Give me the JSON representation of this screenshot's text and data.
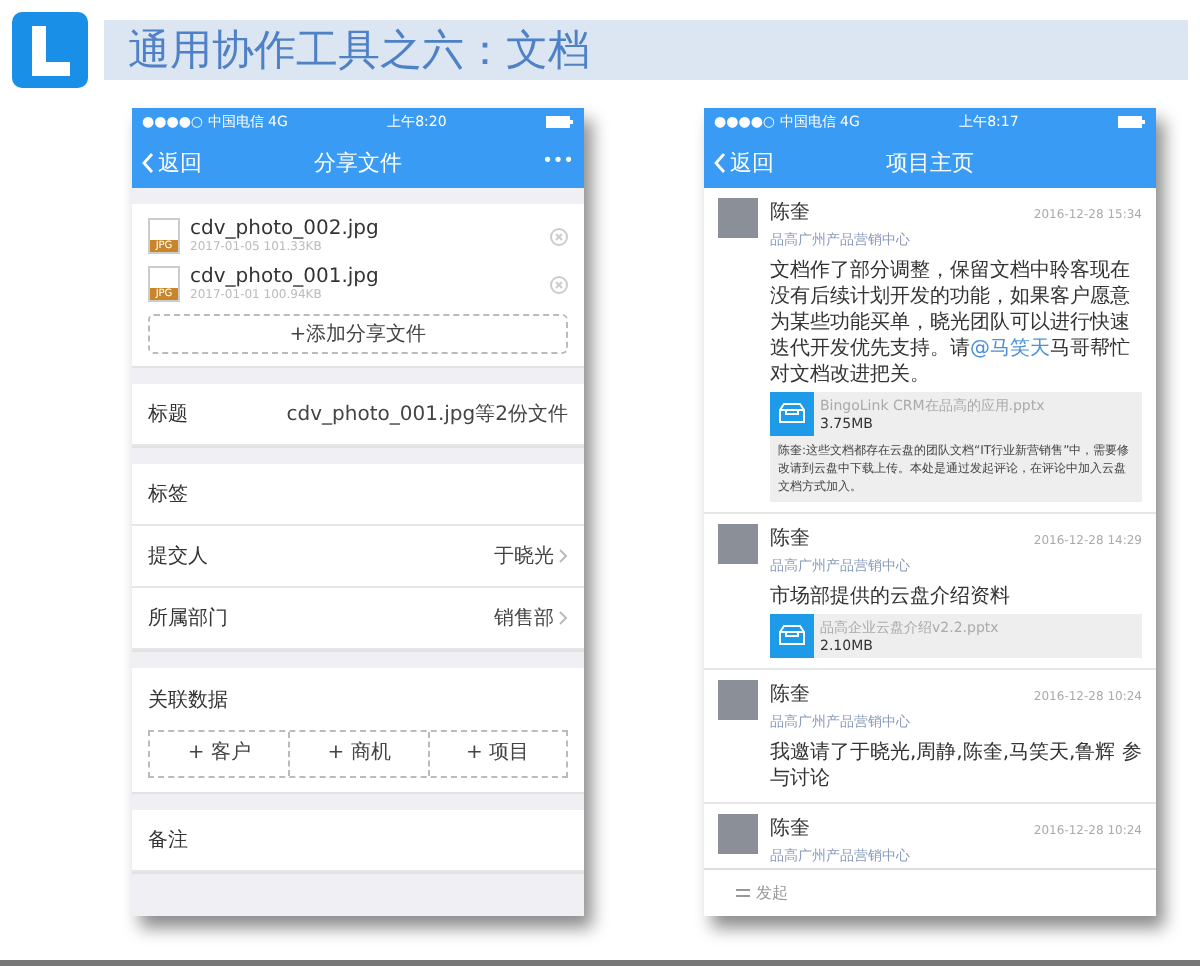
{
  "slide_title": "通用协作工具之六：文档",
  "left_phone": {
    "status_bar": {
      "carrier": "●●●●○ 中国电信  4G",
      "time": "上午8:20"
    },
    "nav": {
      "back": "返回",
      "title": "分享文件",
      "more": "•••"
    },
    "files": [
      {
        "name": "cdv_photo_002.jpg",
        "badge": "JPG",
        "meta": "2017-01-05  101.33KB"
      },
      {
        "name": "cdv_photo_001.jpg",
        "badge": "JPG",
        "meta": "2017-01-01  100.94KB"
      }
    ],
    "add_file": "+添加分享文件",
    "field_groups": [
      [
        {
          "kind": "value",
          "label": "标题",
          "value": "cdv_photo_001.jpg等2份文件"
        }
      ],
      [
        {
          "kind": "empty",
          "label": "标签"
        },
        {
          "kind": "link",
          "label": "提交人",
          "value": "于晓光"
        },
        {
          "kind": "link",
          "label": "所属部门",
          "value": "销售部"
        }
      ]
    ],
    "related": {
      "label": "关联数据",
      "buttons": [
        "+ 客户",
        "+ 商机",
        "+ 项目"
      ]
    },
    "notes": "备注"
  },
  "right_phone": {
    "status_bar": {
      "carrier": "●●●●○ 中国电信  4G",
      "time": "上午8:17"
    },
    "nav": {
      "back": "返回",
      "title": "项目主页"
    },
    "posts": [
      {
        "name": "陈奎",
        "org": "品高广州产品营销中心",
        "time": "2016-12-28 15:34",
        "text": "文档作了部分调整，保留文档中聆客现在没有后续计划开发的功能，如果客户愿意为某些功能买单，晓光团队可以进行快速迭代开发优先支持。请",
        "mention": "@马笑天",
        "text_after": "马哥帮忙对文档改进把关。",
        "attachment": {
          "name": "BingoLink CRM在品高的应用.pptx",
          "size": "3.75MB",
          "note": "陈奎:这些文档都存在云盘的团队文档“IT行业新营销售”中，需要修改请到云盘中下载上传。本处是通过发起评论，在评论中加入云盘文档方式加入。"
        }
      },
      {
        "name": "陈奎",
        "org": "品高广州产品营销中心",
        "time": "2016-12-28 14:29",
        "text": "市场部提供的云盘介绍资料",
        "attachment": {
          "name": "品高企业云盘介绍v2.2.pptx",
          "size": "2.10MB"
        }
      },
      {
        "name": "陈奎",
        "org": "品高广州产品营销中心",
        "time": "2016-12-28 10:24",
        "text": "我邀请了于晓光,周静,陈奎,马笑天,鲁辉 参与讨论"
      },
      {
        "name": "陈奎",
        "org": "品高广州产品营销中心",
        "time": "2016-12-28 10:24"
      }
    ],
    "bottom_action": "发起"
  }
}
